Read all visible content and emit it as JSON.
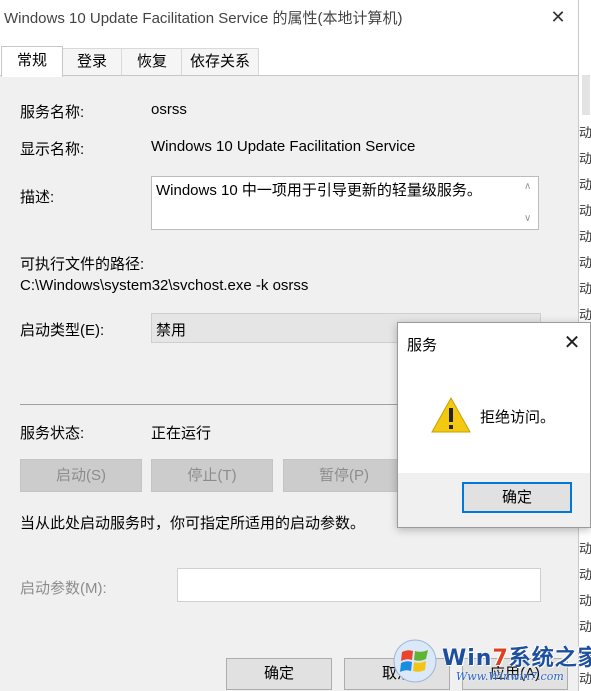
{
  "window": {
    "title": "Windows 10 Update Facilitation Service 的属性(本地计算机)",
    "close_glyph": "✕"
  },
  "tabs": [
    {
      "label": "常规",
      "active": true
    },
    {
      "label": "登录",
      "active": false
    },
    {
      "label": "恢复",
      "active": false
    },
    {
      "label": "依存关系",
      "active": false
    }
  ],
  "general": {
    "service_name_label": "服务名称:",
    "service_name_value": "osrss",
    "display_name_label": "显示名称:",
    "display_name_value": "Windows 10 Update Facilitation Service",
    "description_label": "描述:",
    "description_value": "Windows 10 中一项用于引导更新的轻量级服务。",
    "exe_path_label": "可执行文件的路径:",
    "exe_path_value": "C:\\Windows\\system32\\svchost.exe -k osrss",
    "startup_type_label": "启动类型(E):",
    "startup_type_value": "禁用",
    "status_label": "服务状态:",
    "status_value": "正在运行",
    "buttons": {
      "start": "启动(S)",
      "stop": "停止(T)",
      "pause": "暂停(P)"
    },
    "hint_text": "当从此处启动服务时，你可指定所适用的启动参数。",
    "start_params_label": "启动参数(M):"
  },
  "footer": {
    "ok_label": "确定",
    "cancel_label": "取消",
    "apply_label": "应用(A)"
  },
  "message_dialog": {
    "title": "服务",
    "message": "拒绝访问。",
    "ok_label": "确定",
    "icon": "warning-icon",
    "close_glyph": "✕"
  },
  "background_window": {
    "glyphs": [
      "动",
      "动",
      "动",
      "动",
      "动",
      "动",
      "动",
      "动",
      "动",
      "动",
      "动",
      "动",
      "动",
      "动",
      "动",
      "动",
      "动",
      "动",
      "动",
      "动",
      "动",
      "动"
    ]
  },
  "watermark": {
    "brand_prefix": "Win",
    "brand_seven": "7",
    "brand_suffix": "系统之家",
    "url": "Www.Winwin7.com"
  },
  "colors": {
    "accent": "#0078d7",
    "warning": "#f2c811",
    "disabled_text": "#8c8c8c"
  }
}
